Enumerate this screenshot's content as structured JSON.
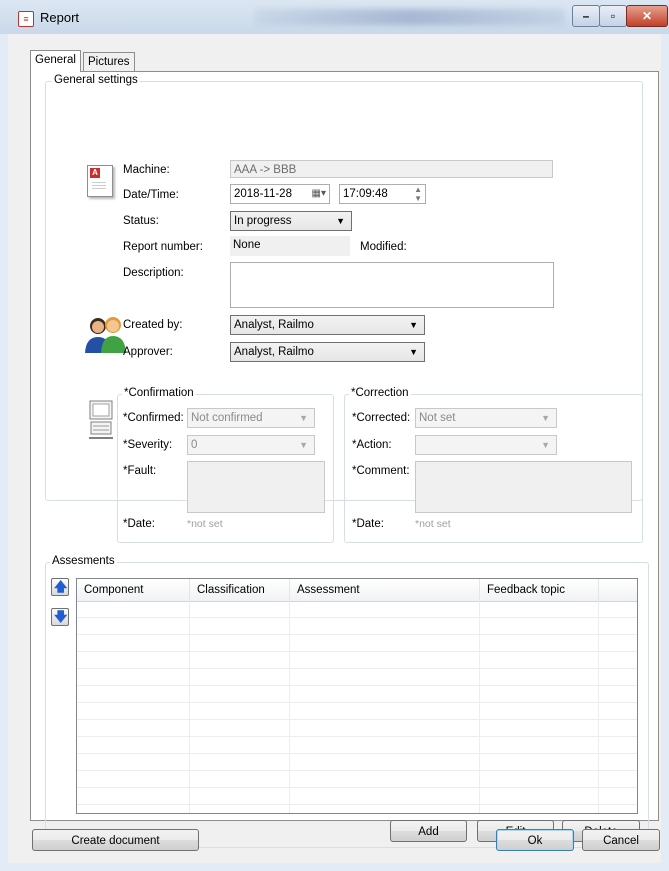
{
  "window": {
    "title": "Report",
    "icon": "report-icon"
  },
  "tabs": [
    {
      "label": "General",
      "active": true
    },
    {
      "label": "Pictures",
      "active": false
    }
  ],
  "general_settings": {
    "title": "General settings",
    "machine_label": "Machine:",
    "machine_value": "AAA -> BBB",
    "datetime_label": "Date/Time:",
    "date_value": "2018-11-28",
    "time_value": "17:09:48",
    "status_label": "Status:",
    "status_value": "In progress",
    "report_number_label": "Report number:",
    "report_number_value": "None",
    "modified_label": "Modified:",
    "description_label": "Description:",
    "description_value": "",
    "created_by_label": "Created by:",
    "created_by_value": "Analyst, Railmo",
    "approver_label": "Approver:",
    "approver_value": "Analyst, Railmo"
  },
  "confirmation": {
    "title": "*Confirmation",
    "confirmed_label": "*Confirmed:",
    "confirmed_value": "Not confirmed",
    "severity_label": "*Severity:",
    "severity_value": "0",
    "fault_label": "*Fault:",
    "date_label": "*Date:",
    "date_value": "*not set"
  },
  "correction": {
    "title": "*Correction",
    "corrected_label": "*Corrected:",
    "corrected_value": "Not set",
    "action_label": "*Action:",
    "action_value": "",
    "comment_label": "*Comment:",
    "date_label": "*Date:",
    "date_value": "*not set"
  },
  "assessments": {
    "title": "Assesments",
    "columns": [
      "Component",
      "Classification",
      "Assessment",
      "Feedback topic"
    ],
    "rows": [],
    "add_label": "Add",
    "edit_label": "Edit",
    "delete_label": "Delete",
    "up_icon": "arrow-up-icon",
    "down_icon": "arrow-down-icon"
  },
  "footer": {
    "create_document_label": "Create document",
    "ok_label": "Ok",
    "cancel_label": "Cancel"
  }
}
